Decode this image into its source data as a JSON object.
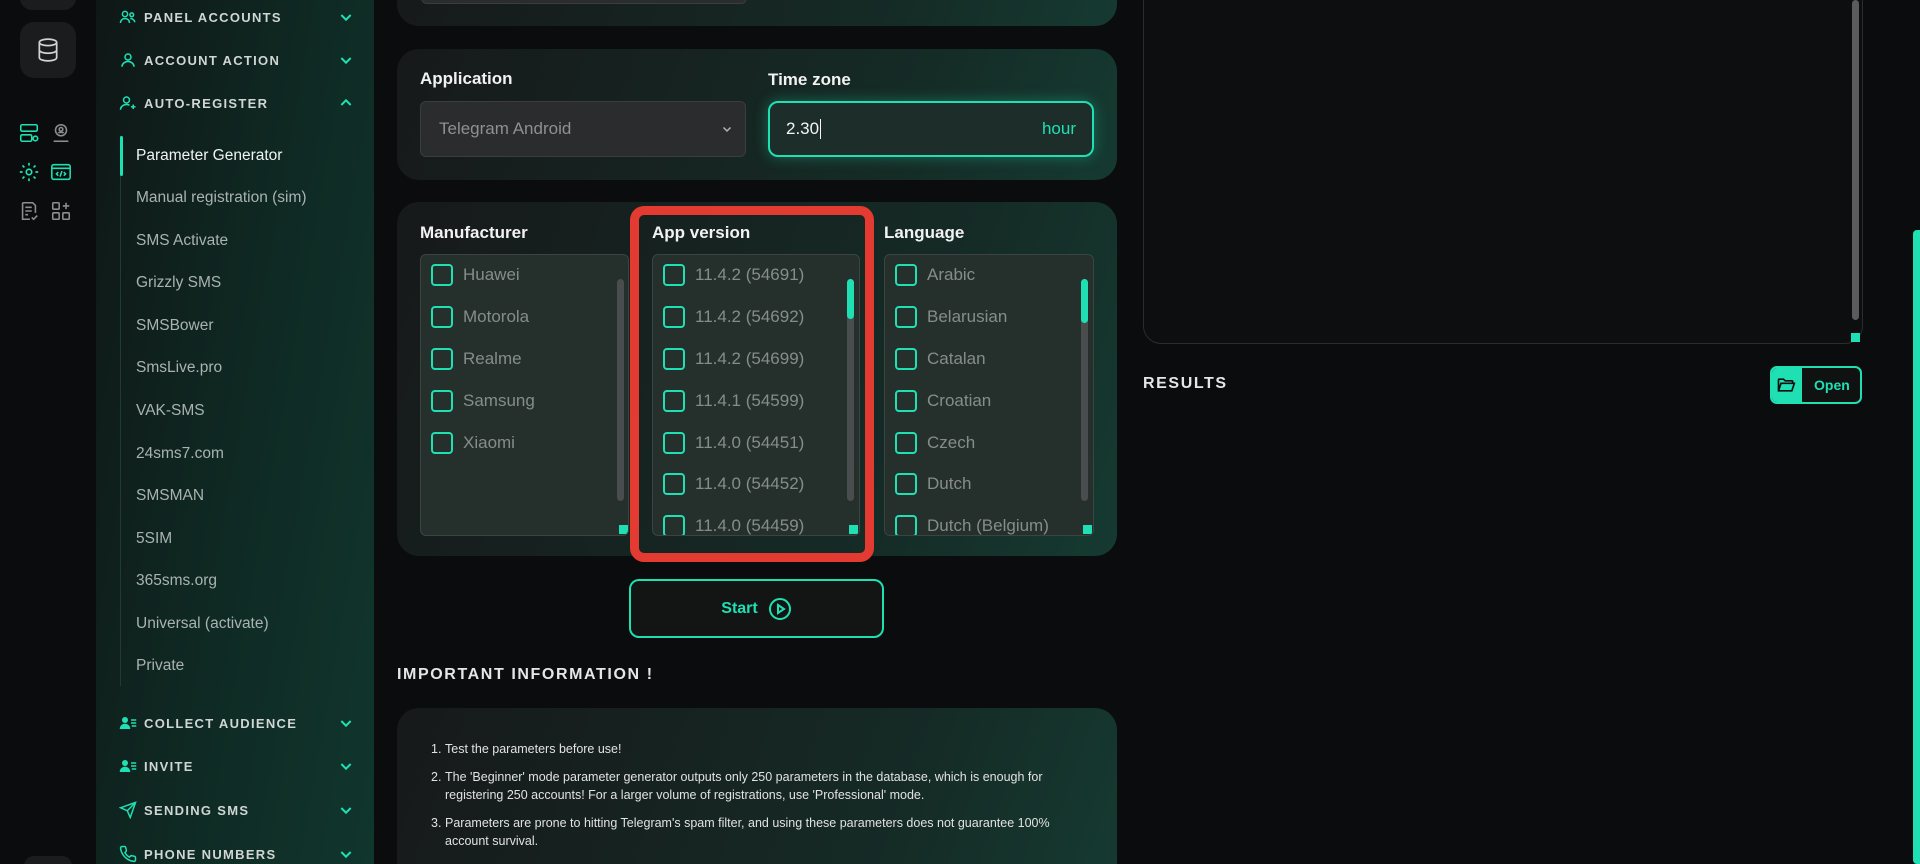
{
  "nav": {
    "sections": [
      {
        "label": "PANEL ACCOUNTS",
        "icon": "users-icon"
      },
      {
        "label": "ACCOUNT ACTION",
        "icon": "user-icon"
      },
      {
        "label": "AUTO-REGISTER",
        "icon": "user-plus-icon"
      },
      {
        "label": "COLLECT AUDIENCE",
        "icon": "user-list-icon"
      },
      {
        "label": "INVITE",
        "icon": "user-list-icon"
      },
      {
        "label": "SENDING SMS",
        "icon": "send-icon"
      },
      {
        "label": "PHONE NUMBERS",
        "icon": "phone-icon"
      }
    ],
    "auto_register_items": [
      "Parameter Generator",
      "Manual registration (sim)",
      "SMS Activate",
      "Grizzly SMS",
      "SMSBower",
      "SmsLive.pro",
      "VAK-SMS",
      "24sms7.com",
      "SMSMAN",
      "5SIM",
      "365sms.org",
      "Universal (activate)",
      "Private"
    ]
  },
  "application": {
    "label": "Application",
    "selected": "Telegram Android"
  },
  "timezone": {
    "label": "Time zone",
    "value": "2.30",
    "unit": "hour"
  },
  "manufacturer": {
    "label": "Manufacturer",
    "options": [
      "Huawei",
      "Motorola",
      "Realme",
      "Samsung",
      "Xiaomi"
    ]
  },
  "app_version": {
    "label": "App version",
    "options": [
      "11.4.2 (54691)",
      "11.4.2 (54692)",
      "11.4.2 (54699)",
      "11.4.1 (54599)",
      "11.4.0 (54451)",
      "11.4.0 (54452)",
      "11.4.0 (54459)"
    ]
  },
  "language": {
    "label": "Language",
    "options": [
      "Arabic",
      "Belarusian",
      "Catalan",
      "Croatian",
      "Czech",
      "Dutch",
      "Dutch (Belgium)"
    ]
  },
  "start_label": "Start",
  "info": {
    "title": "IMPORTANT INFORMATION !",
    "items": [
      "Test the parameters before use!",
      "The 'Beginner' mode parameter generator outputs only 250 parameters in the database, which is enough for registering 250 accounts! For a larger volume of registrations, use 'Professional' mode.",
      "Parameters are prone to hitting Telegram's spam filter, and using these parameters does not guarantee 100% account survival."
    ]
  },
  "results": {
    "label": "RESULTS",
    "open_label": "Open"
  },
  "colors": {
    "accent": "#1fe0b3",
    "highlight": "#e33a32",
    "background": "#0b0c0d"
  }
}
